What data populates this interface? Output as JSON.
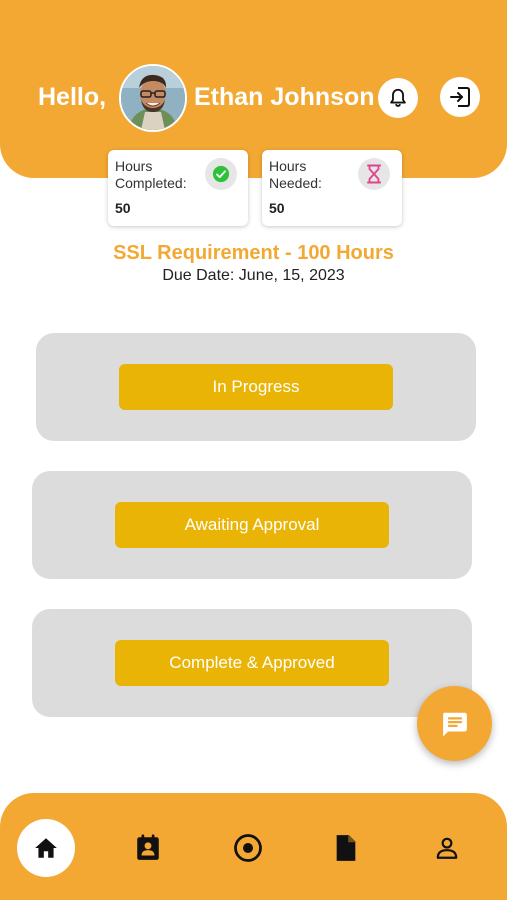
{
  "header": {
    "greeting": "Hello,",
    "user_name": "Ethan Johnson",
    "icons": {
      "notifications": "bell-icon",
      "logout": "logout-icon"
    }
  },
  "stats": [
    {
      "label": "Hours\nCompleted:",
      "value": "50",
      "icon": "check-circle-icon",
      "icon_color": "#2EC23A"
    },
    {
      "label": "Hours\nNeeded:",
      "value": "50",
      "icon": "hourglass-icon",
      "icon_color": "#E0438C"
    }
  ],
  "requirement": {
    "title": "SSL Requirement - 100 Hours",
    "due_date": "Due Date: June, 15, 2023"
  },
  "status_buttons": [
    {
      "label": "In Progress"
    },
    {
      "label": "Awaiting Approval"
    },
    {
      "label": "Complete & Approved"
    }
  ],
  "chat": {
    "icon": "chat-icon"
  },
  "bottom_nav": [
    {
      "icon": "home-icon",
      "active": true
    },
    {
      "icon": "contact-book-icon",
      "active": false
    },
    {
      "icon": "target-icon",
      "active": false
    },
    {
      "icon": "document-icon",
      "active": false
    },
    {
      "icon": "profile-icon",
      "active": false
    }
  ],
  "colors": {
    "primary": "#F3A833",
    "button": "#E9B405",
    "panel": "#DCDCDC"
  }
}
